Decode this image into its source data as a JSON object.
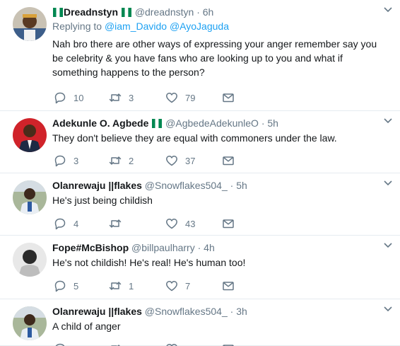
{
  "tweets": [
    {
      "name": "Dreadnstyn",
      "flag_before": true,
      "flag_after": true,
      "handle": "@dreadnstyn",
      "separator": "·",
      "time": "6h",
      "reply_label": "Replying to",
      "reply_to": [
        "@iam_Davido",
        "@AyoJaguda"
      ],
      "text": "Nah bro there are other ways of expressing your anger remember say you be celebrity & you have fans who are looking up to you and what if something happens to the person?",
      "replies": "10",
      "retweets": "3",
      "likes": "79"
    },
    {
      "name": "Adekunle O. Agbede",
      "flag_after": true,
      "handle": "@AgbedeAdekunleO",
      "separator": "·",
      "time": "5h",
      "text": "They don't believe they are equal with commoners under the law.",
      "replies": "3",
      "retweets": "2",
      "likes": "37"
    },
    {
      "name": "Olanrewaju ||flakes",
      "handle": "@Snowflakes504_",
      "separator": "·",
      "time": "5h",
      "text": "He's just being childish",
      "replies": "4",
      "retweets": "",
      "likes": "43"
    },
    {
      "name": "Fope#McBishop",
      "handle": "@billpaulharry",
      "separator": "·",
      "time": "4h",
      "text": "He's not childish! He's real! He's human too!",
      "replies": "5",
      "retweets": "1",
      "likes": "7"
    },
    {
      "name": "Olanrewaju ||flakes",
      "handle": "@Snowflakes504_",
      "separator": "·",
      "time": "3h",
      "text": "A child of anger",
      "replies": "",
      "retweets": "",
      "likes": ""
    }
  ],
  "icons": {
    "reply": "reply-icon",
    "retweet": "retweet-icon",
    "like": "heart-icon",
    "dm": "envelope-icon",
    "more": "chevron-down-icon"
  },
  "colors": {
    "text": "#14171a",
    "secondary": "#657786",
    "link": "#1da1f2",
    "divider": "#e6ecf0",
    "flag_green": "#008751"
  }
}
